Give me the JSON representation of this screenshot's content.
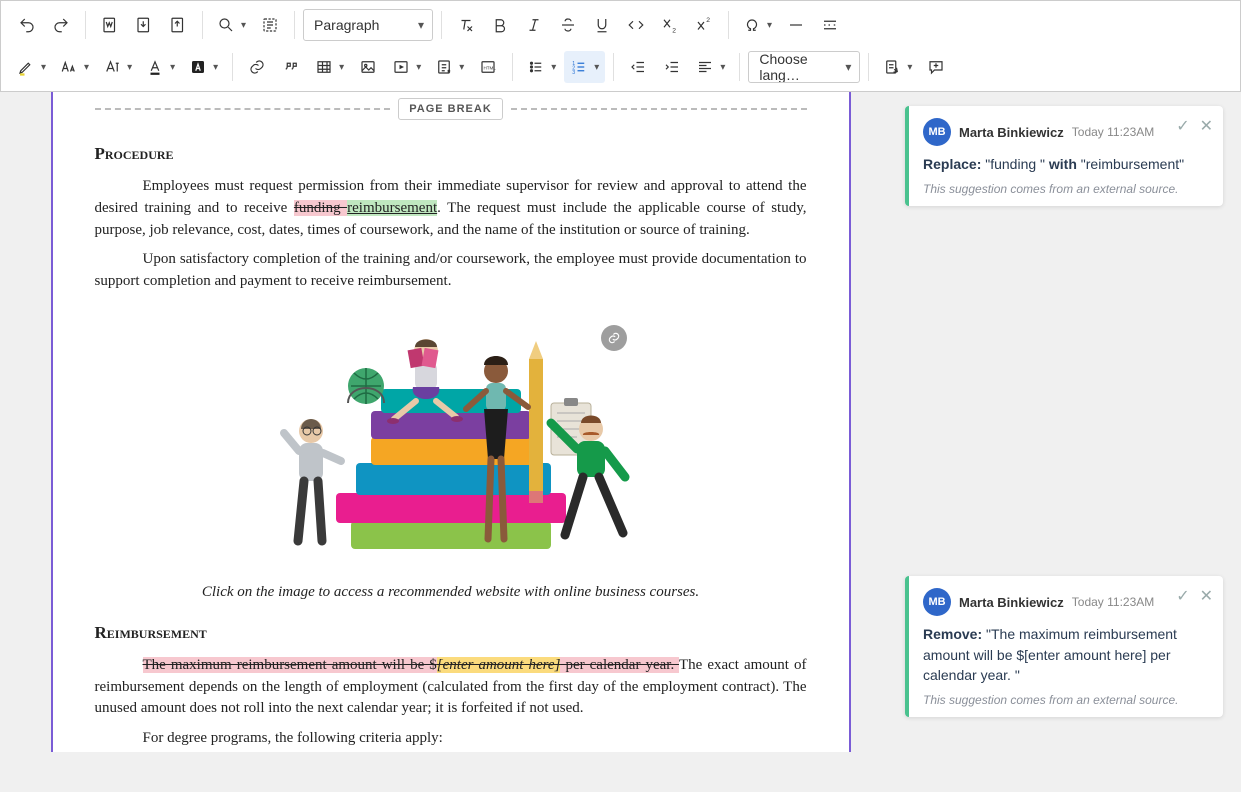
{
  "toolbar": {
    "paragraph_style": "Paragraph",
    "language_select": "Choose lang…"
  },
  "document": {
    "page_break_label": "PAGE BREAK",
    "section1_title": "Procedure",
    "p1_a": "Employees must request permission from their immediate supervisor for review and approval to attend the desired training and to receive ",
    "p1_del": "funding ",
    "p1_ins": "reimbursement",
    "p1_b": ". The request must include the applicable course of study, purpose, job relevance, cost, dates, times of coursework, and the name of the institution or source of training.",
    "p2": "Upon satisfactory completion of the training and/or coursework, the employee must provide documentation to support completion and payment to receive reimbursement.",
    "caption": "Click on the image to access a recommended website with online business courses.",
    "section2_title": "Reimbursement",
    "p3_del_a": "The maximum reimbursement amount will be $",
    "p3_del_marker": "[enter amount here]",
    "p3_del_b": " per calendar year. ",
    "p3_rest": "The exact amount of reimbursement depends on the length of employment (calculated from the first day of the employment contract). The unused amount does not roll into the next calendar year; it is forfeited if not used.",
    "p4": "For degree programs, the following criteria apply:"
  },
  "comments": [
    {
      "initials": "MB",
      "author": "Marta Binkiewicz",
      "time": "Today 11:23AM",
      "action": "Replace:",
      "quoted_from": "\"funding \"",
      "joiner": " with ",
      "quoted_to": "\"reimbursement\"",
      "note": "This suggestion comes from an external source."
    },
    {
      "initials": "MB",
      "author": "Marta Binkiewicz",
      "time": "Today 11:23AM",
      "action": "Remove:",
      "quoted_from": "\"The maximum reimbursement amount will be $[enter amount here] per calendar year. \"",
      "joiner": "",
      "quoted_to": "",
      "note": "This suggestion comes from an external source."
    }
  ]
}
